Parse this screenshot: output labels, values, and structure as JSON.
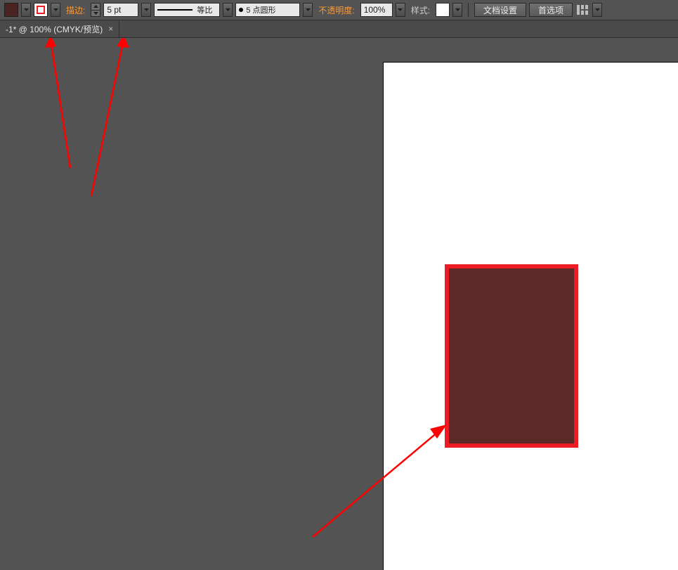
{
  "toolbar": {
    "fill_color": "#4a2323",
    "stroke_color": "#ed1c24",
    "stroke_label": "描边:",
    "stroke_weight": "5 pt",
    "profile_label": "等比",
    "dashes_label": "5 点圆形",
    "opacity_label": "不透明度:",
    "opacity_value": "100%",
    "style_label": "样式:",
    "doc_setup_label": "文档设置",
    "prefs_label": "首选项"
  },
  "tab": {
    "title": "-1* @ 100% (CMYK/预览)"
  },
  "artboard": {
    "rect_fill": "#5c2828",
    "rect_stroke": "#ed1c24"
  },
  "annotation_color": "#ff0000"
}
